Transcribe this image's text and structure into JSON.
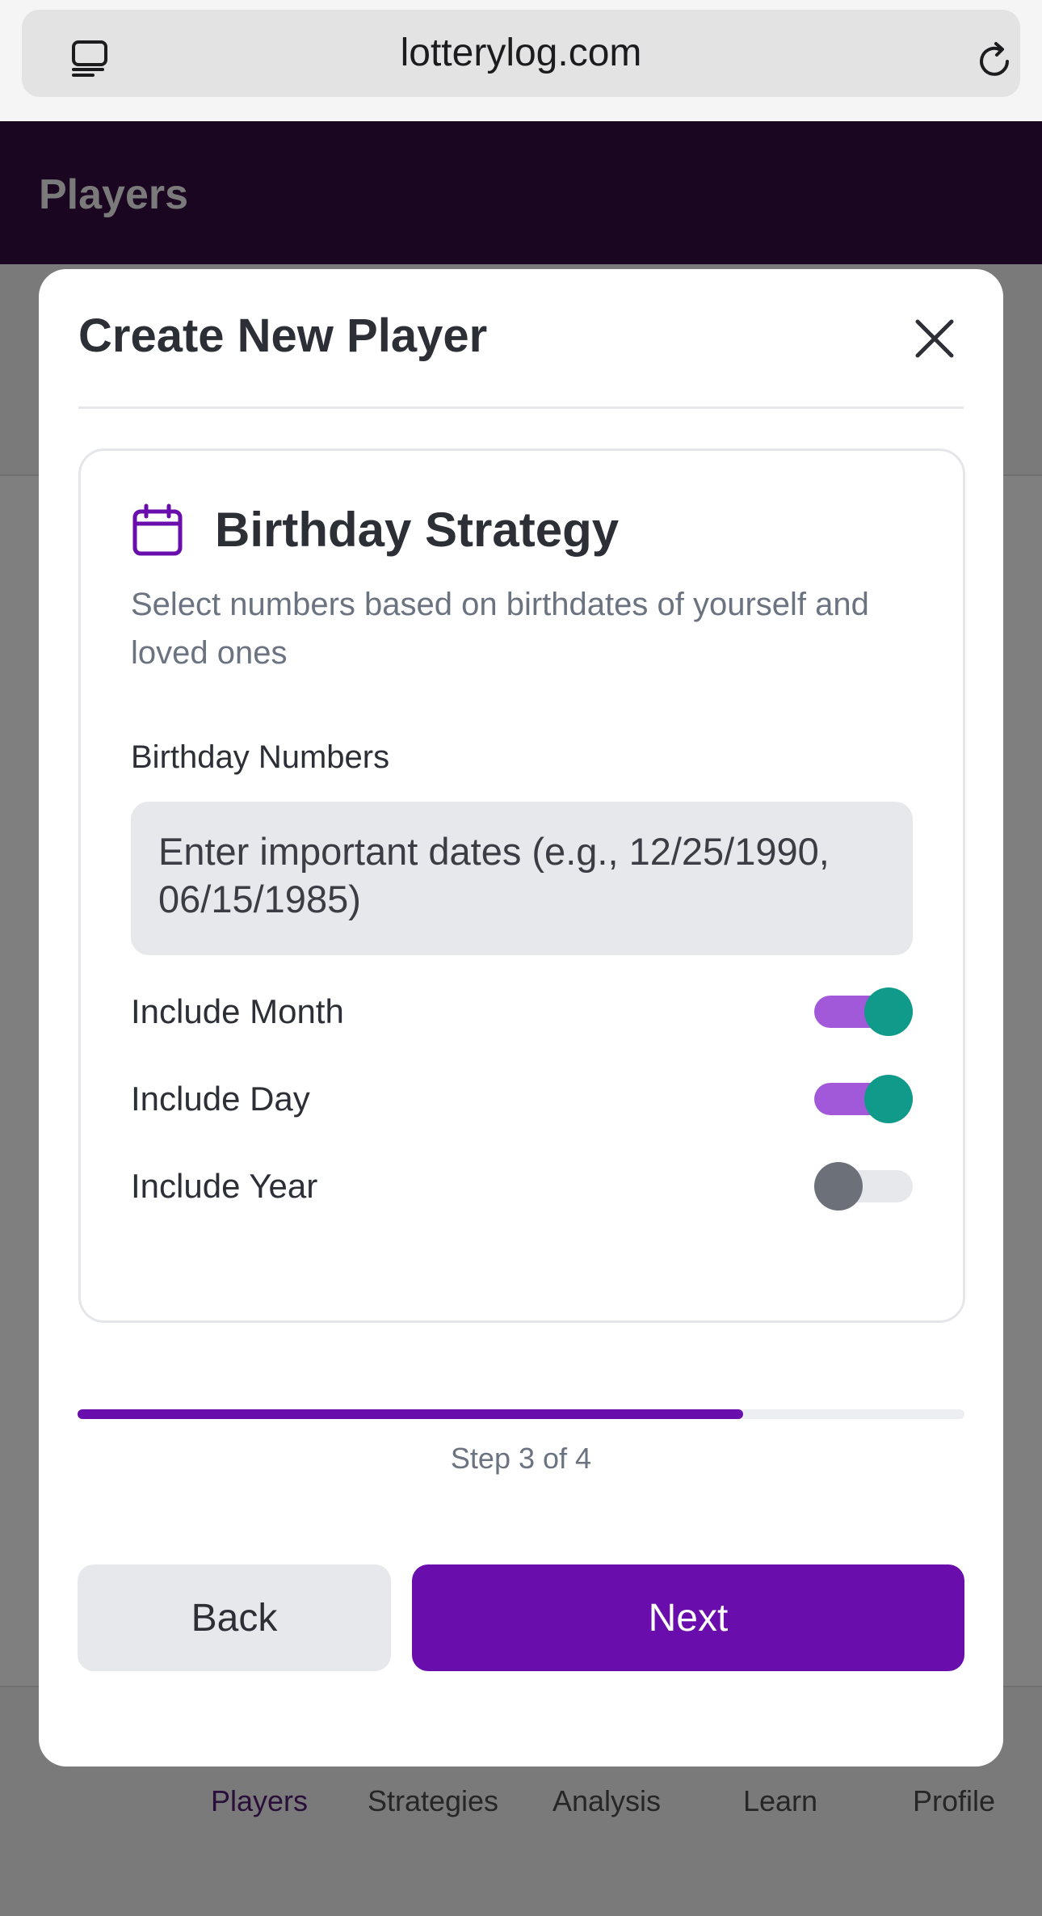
{
  "browser": {
    "url": "lotterylog.com",
    "tabs_icon": "tabs-icon",
    "reload_icon": "reload-icon"
  },
  "app_header": {
    "title": "Players"
  },
  "bottom_nav": {
    "items": [
      {
        "label": "Players",
        "active": true
      },
      {
        "label": "Strategies",
        "active": false
      },
      {
        "label": "Analysis",
        "active": false
      },
      {
        "label": "Learn",
        "active": false
      },
      {
        "label": "Profile",
        "active": false
      }
    ]
  },
  "modal": {
    "title": "Create New Player",
    "close_icon": "close-icon",
    "strategy_card": {
      "icon": "calendar-icon",
      "title": "Birthday Strategy",
      "description": "Select numbers based on birthdates of yourself and loved ones",
      "field_label": "Birthday Numbers",
      "input_placeholder": "Enter important dates (e.g., 12/25/1990, 06/15/1985)",
      "input_value": "",
      "toggles": [
        {
          "label": "Include Month",
          "on": true
        },
        {
          "label": "Include Day",
          "on": true
        },
        {
          "label": "Include Year",
          "on": false
        }
      ]
    },
    "progress": {
      "fraction": 0.75,
      "text": "Step 3 of 4"
    },
    "buttons": {
      "back": "Back",
      "next": "Next"
    }
  },
  "colors": {
    "accent": "#6a0dad",
    "toggle_track_on": "#a259d9",
    "toggle_knob_on": "#0f9a89",
    "toggle_knob_off": "#6b7079",
    "header_bg": "#1b0622",
    "overlay": "#7f7f7f"
  }
}
